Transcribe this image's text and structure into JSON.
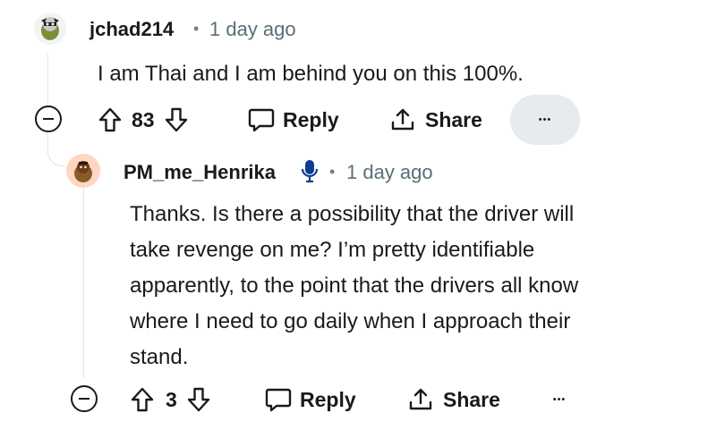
{
  "comment1": {
    "username": "jchad214",
    "separator": "•",
    "time": "1 day ago",
    "text": "I am Thai and I am behind you on this 100%.",
    "votes": "83",
    "reply_label": "Reply",
    "share_label": "Share",
    "more_label": "•••"
  },
  "comment2": {
    "username": "PM_me_Henrika",
    "separator": "•",
    "time": "1 day ago",
    "text_lines": [
      "Thanks. Is there a possibility that the driver will",
      "take revenge on me? I’m pretty identifiable",
      "apparently, to the point that the drivers all know",
      "where I need to go daily when I approach their",
      "stand."
    ],
    "votes": "3",
    "reply_label": "Reply",
    "share_label": "Share",
    "more_label": "•••"
  },
  "icons": {
    "collapse": "collapse-icon",
    "upvote": "upvote-icon",
    "downvote": "downvote-icon",
    "reply": "reply-icon",
    "share": "share-icon",
    "more": "more-icon",
    "mic": "microphone-icon"
  }
}
